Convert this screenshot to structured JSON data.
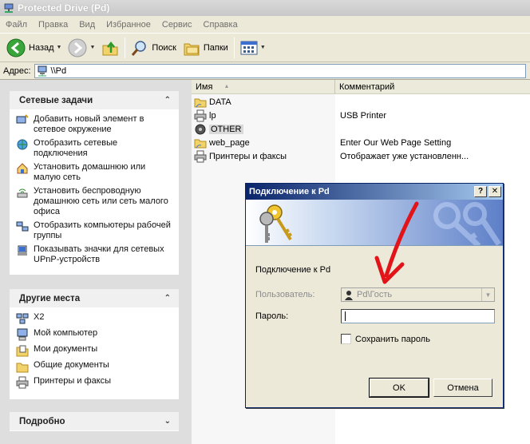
{
  "window": {
    "title": "Protected Drive (Pd)"
  },
  "menu": [
    "Файл",
    "Правка",
    "Вид",
    "Избранное",
    "Сервис",
    "Справка"
  ],
  "toolbar": {
    "back": "Назад",
    "search": "Поиск",
    "folders": "Папки"
  },
  "address": {
    "label": "Адрес:",
    "value": "\\\\Pd"
  },
  "tasks_panel": {
    "title": "Сетевые задачи",
    "items": [
      "Добавить новый элемент в сетевое окружение",
      "Отобразить сетевые подключения",
      "Установить домашнюю или малую сеть",
      "Установить беспроводную домашнюю сеть или сеть малого офиса",
      "Отобразить компьютеры рабочей группы",
      "Показывать значки для сетевых UPnP-устройств"
    ]
  },
  "places_panel": {
    "title": "Другие места",
    "items": [
      "X2",
      "Мой компьютер",
      "Мои документы",
      "Общие документы",
      "Принтеры и факсы"
    ]
  },
  "details_panel": {
    "title": "Подробно"
  },
  "columns": {
    "name": "Имя",
    "comment": "Комментарий"
  },
  "files": [
    {
      "name": "DATA",
      "comment": ""
    },
    {
      "name": "lp",
      "comment": "USB Printer"
    },
    {
      "name": "OTHER",
      "comment": ""
    },
    {
      "name": "web_page",
      "comment": "Enter Our Web Page Setting"
    },
    {
      "name": "Принтеры и факсы",
      "comment": "Отображает уже установленн..."
    }
  ],
  "dialog": {
    "title": "Подключение к Pd",
    "help_button": "?",
    "close_button": "✕",
    "message": "Подключение к Pd",
    "user_label": "Пользователь:",
    "user_value": "Pd\\Гость",
    "password_label": "Пароль:",
    "save_label": "Сохранить пароль",
    "ok": "OK",
    "cancel": "Отмена"
  }
}
